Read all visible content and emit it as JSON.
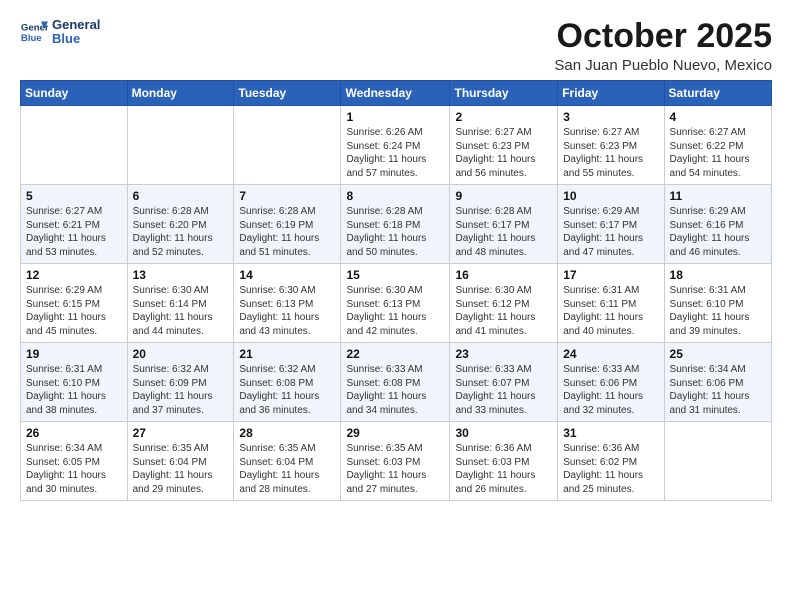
{
  "logo": {
    "line1": "General",
    "line2": "Blue"
  },
  "title": "October 2025",
  "subtitle": "San Juan Pueblo Nuevo, Mexico",
  "weekdays": [
    "Sunday",
    "Monday",
    "Tuesday",
    "Wednesday",
    "Thursday",
    "Friday",
    "Saturday"
  ],
  "weeks": [
    [
      {
        "day": "",
        "info": ""
      },
      {
        "day": "",
        "info": ""
      },
      {
        "day": "",
        "info": ""
      },
      {
        "day": "1",
        "info": "Sunrise: 6:26 AM\nSunset: 6:24 PM\nDaylight: 11 hours\nand 57 minutes."
      },
      {
        "day": "2",
        "info": "Sunrise: 6:27 AM\nSunset: 6:23 PM\nDaylight: 11 hours\nand 56 minutes."
      },
      {
        "day": "3",
        "info": "Sunrise: 6:27 AM\nSunset: 6:23 PM\nDaylight: 11 hours\nand 55 minutes."
      },
      {
        "day": "4",
        "info": "Sunrise: 6:27 AM\nSunset: 6:22 PM\nDaylight: 11 hours\nand 54 minutes."
      }
    ],
    [
      {
        "day": "5",
        "info": "Sunrise: 6:27 AM\nSunset: 6:21 PM\nDaylight: 11 hours\nand 53 minutes."
      },
      {
        "day": "6",
        "info": "Sunrise: 6:28 AM\nSunset: 6:20 PM\nDaylight: 11 hours\nand 52 minutes."
      },
      {
        "day": "7",
        "info": "Sunrise: 6:28 AM\nSunset: 6:19 PM\nDaylight: 11 hours\nand 51 minutes."
      },
      {
        "day": "8",
        "info": "Sunrise: 6:28 AM\nSunset: 6:18 PM\nDaylight: 11 hours\nand 50 minutes."
      },
      {
        "day": "9",
        "info": "Sunrise: 6:28 AM\nSunset: 6:17 PM\nDaylight: 11 hours\nand 48 minutes."
      },
      {
        "day": "10",
        "info": "Sunrise: 6:29 AM\nSunset: 6:17 PM\nDaylight: 11 hours\nand 47 minutes."
      },
      {
        "day": "11",
        "info": "Sunrise: 6:29 AM\nSunset: 6:16 PM\nDaylight: 11 hours\nand 46 minutes."
      }
    ],
    [
      {
        "day": "12",
        "info": "Sunrise: 6:29 AM\nSunset: 6:15 PM\nDaylight: 11 hours\nand 45 minutes."
      },
      {
        "day": "13",
        "info": "Sunrise: 6:30 AM\nSunset: 6:14 PM\nDaylight: 11 hours\nand 44 minutes."
      },
      {
        "day": "14",
        "info": "Sunrise: 6:30 AM\nSunset: 6:13 PM\nDaylight: 11 hours\nand 43 minutes."
      },
      {
        "day": "15",
        "info": "Sunrise: 6:30 AM\nSunset: 6:13 PM\nDaylight: 11 hours\nand 42 minutes."
      },
      {
        "day": "16",
        "info": "Sunrise: 6:30 AM\nSunset: 6:12 PM\nDaylight: 11 hours\nand 41 minutes."
      },
      {
        "day": "17",
        "info": "Sunrise: 6:31 AM\nSunset: 6:11 PM\nDaylight: 11 hours\nand 40 minutes."
      },
      {
        "day": "18",
        "info": "Sunrise: 6:31 AM\nSunset: 6:10 PM\nDaylight: 11 hours\nand 39 minutes."
      }
    ],
    [
      {
        "day": "19",
        "info": "Sunrise: 6:31 AM\nSunset: 6:10 PM\nDaylight: 11 hours\nand 38 minutes."
      },
      {
        "day": "20",
        "info": "Sunrise: 6:32 AM\nSunset: 6:09 PM\nDaylight: 11 hours\nand 37 minutes."
      },
      {
        "day": "21",
        "info": "Sunrise: 6:32 AM\nSunset: 6:08 PM\nDaylight: 11 hours\nand 36 minutes."
      },
      {
        "day": "22",
        "info": "Sunrise: 6:33 AM\nSunset: 6:08 PM\nDaylight: 11 hours\nand 34 minutes."
      },
      {
        "day": "23",
        "info": "Sunrise: 6:33 AM\nSunset: 6:07 PM\nDaylight: 11 hours\nand 33 minutes."
      },
      {
        "day": "24",
        "info": "Sunrise: 6:33 AM\nSunset: 6:06 PM\nDaylight: 11 hours\nand 32 minutes."
      },
      {
        "day": "25",
        "info": "Sunrise: 6:34 AM\nSunset: 6:06 PM\nDaylight: 11 hours\nand 31 minutes."
      }
    ],
    [
      {
        "day": "26",
        "info": "Sunrise: 6:34 AM\nSunset: 6:05 PM\nDaylight: 11 hours\nand 30 minutes."
      },
      {
        "day": "27",
        "info": "Sunrise: 6:35 AM\nSunset: 6:04 PM\nDaylight: 11 hours\nand 29 minutes."
      },
      {
        "day": "28",
        "info": "Sunrise: 6:35 AM\nSunset: 6:04 PM\nDaylight: 11 hours\nand 28 minutes."
      },
      {
        "day": "29",
        "info": "Sunrise: 6:35 AM\nSunset: 6:03 PM\nDaylight: 11 hours\nand 27 minutes."
      },
      {
        "day": "30",
        "info": "Sunrise: 6:36 AM\nSunset: 6:03 PM\nDaylight: 11 hours\nand 26 minutes."
      },
      {
        "day": "31",
        "info": "Sunrise: 6:36 AM\nSunset: 6:02 PM\nDaylight: 11 hours\nand 25 minutes."
      },
      {
        "day": "",
        "info": ""
      }
    ]
  ]
}
